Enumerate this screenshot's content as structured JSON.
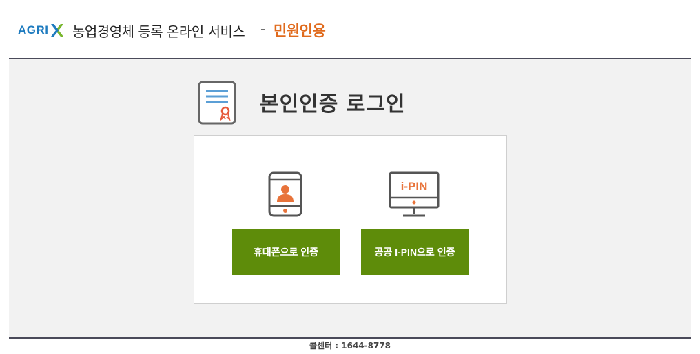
{
  "header": {
    "logo_text": "AGRI",
    "logo_icon": "x-mark-icon",
    "site_title": "농업경영체 등록 온라인 서비스",
    "separator": "-",
    "subtitle": "민원인용"
  },
  "main": {
    "page_title": "본인인증 로그인",
    "page_icon": "certificate-icon",
    "options": [
      {
        "icon": "phone-person-icon",
        "label": "휴대폰으로 인증"
      },
      {
        "icon": "ipin-monitor-icon",
        "icon_text": "i-PIN",
        "label": "공공 I-PIN으로 인증"
      }
    ]
  },
  "footer": {
    "call_center": "콜센터 : 1644-8778"
  },
  "colors": {
    "brand_blue": "#1e7bbf",
    "brand_green": "#5e8c0a",
    "accent_orange": "#e06a1c",
    "button_green": "#5e8c0a",
    "divider": "#4a4a5a"
  }
}
